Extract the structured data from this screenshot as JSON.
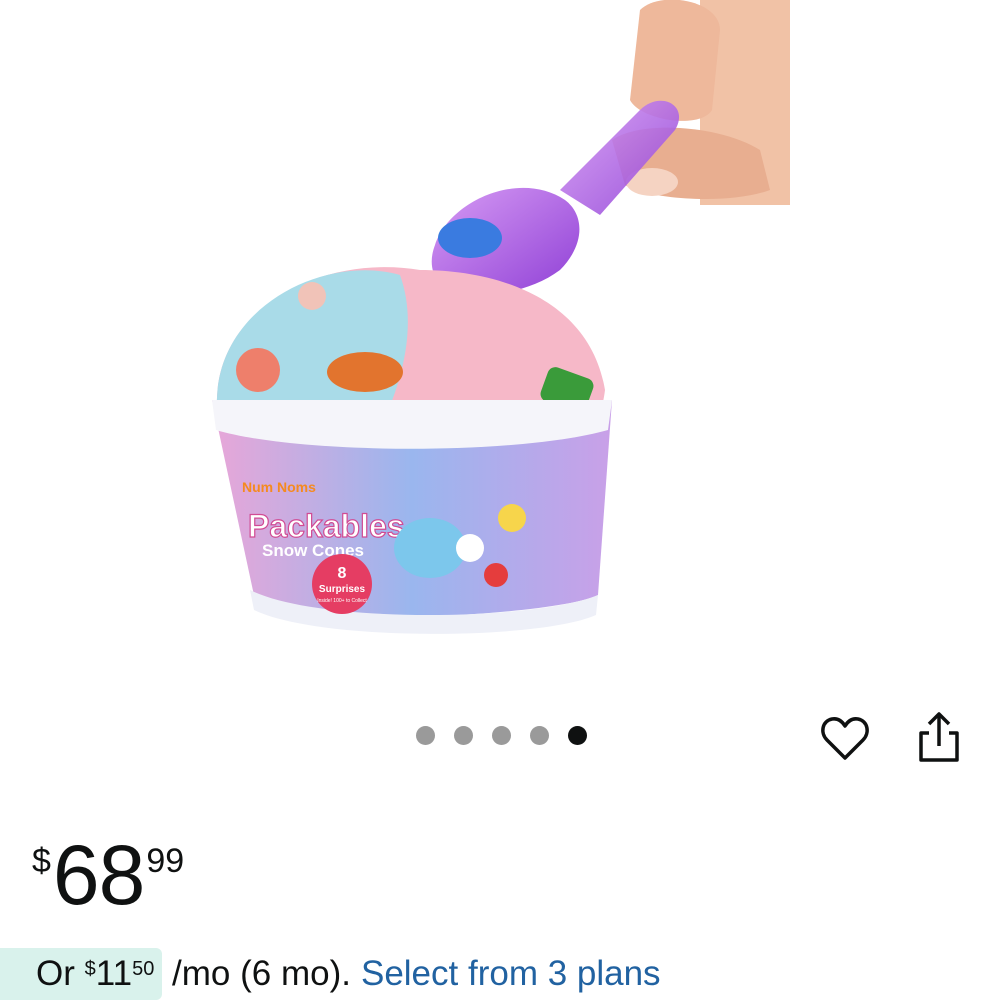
{
  "product_image": {
    "tub_brand": "Num Noms",
    "tub_title": "Packables",
    "tub_subtitle": "Snow Cones",
    "tub_surprise_count": "8",
    "tub_surprise_label": "Surprises",
    "tub_surprise_note": "Inside! 100+ to Collect"
  },
  "carousel": {
    "dot_count": 5,
    "active_index": 4
  },
  "icons": {
    "wishlist": "heart-icon",
    "share": "share-icon"
  },
  "price": {
    "symbol": "$",
    "whole": "68",
    "fraction": "99"
  },
  "installment": {
    "prefix": "Or ",
    "symbol": "$",
    "whole": "11",
    "fraction": "50",
    "suffix": " /mo (6 mo).",
    "link_text": "Select from 3 plans"
  },
  "colors": {
    "link": "#2162a1",
    "installment_bg": "#d9f2ec",
    "active_dot": "#0f1111",
    "inactive_dot": "#9a9a9a"
  }
}
